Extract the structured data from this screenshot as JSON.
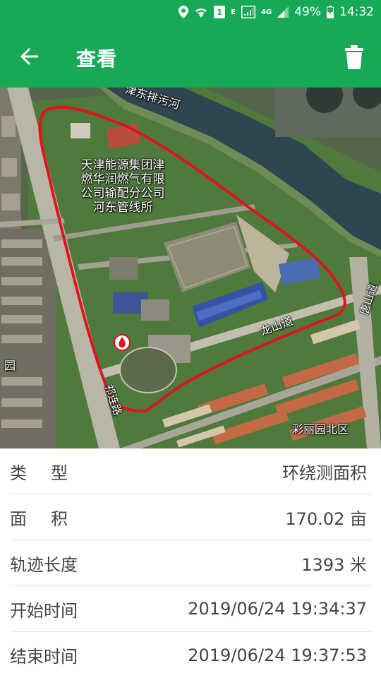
{
  "status_bar": {
    "sim_label": "1",
    "e_label": "E",
    "network": "4G",
    "battery": "49%",
    "time": "14:32"
  },
  "app_bar": {
    "title": "查看"
  },
  "map": {
    "labels": {
      "river": "津东排污河",
      "poi_line1": "天津能源集团津",
      "poi_line2": "燃华润燃气有限",
      "poi_line3": "公司输配分公司",
      "poi_line4": "河东管线所",
      "road_longshan": "龙山道",
      "road_qishan": "祁连路",
      "road_tangshan": "唐山道",
      "area_caili": "彩丽园北区",
      "area_left": "园"
    },
    "route_color": "#e0141e"
  },
  "info": {
    "rows": [
      {
        "label": "类型",
        "value": "环绕测面积"
      },
      {
        "label": "面积",
        "value": "170.02 亩"
      },
      {
        "label": "轨迹长度",
        "value": "1393 米"
      },
      {
        "label": "开始时间",
        "value": "2019/06/24 19:34:37"
      },
      {
        "label": "结束时间",
        "value": "2019/06/24 19:37:53"
      }
    ]
  }
}
